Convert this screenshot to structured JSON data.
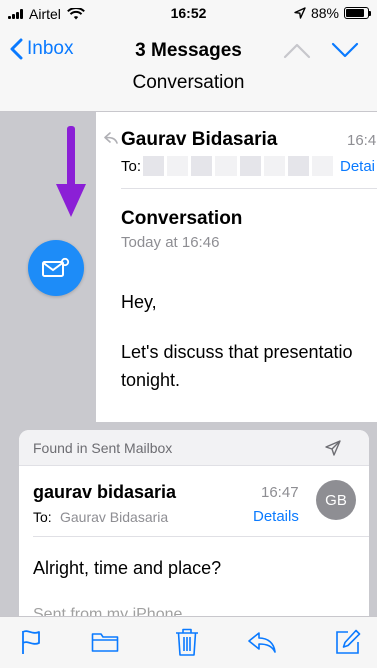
{
  "status_bar": {
    "carrier": "Airtel",
    "time": "16:52",
    "battery": "88%",
    "battery_level": 0.88
  },
  "nav": {
    "back_label": "Inbox",
    "title": "3 Messages",
    "subtitle": "Conversation"
  },
  "message1": {
    "sender": "Gaurav Bidasaria",
    "time": "16:4",
    "to_label": "To:",
    "details": "Detai",
    "subject": "Conversation",
    "date": "Today at 16:46",
    "body": [
      "Hey,",
      "Let's discuss that presentatio tonight."
    ]
  },
  "message2": {
    "found_in": "Found in Sent Mailbox",
    "sender": "gaurav bidasaria",
    "time": "16:47",
    "avatar_initials": "GB",
    "to_label": "To:",
    "to_value": "Gaurav Bidasaria",
    "details": "Details",
    "body": "Alright, time and place?",
    "signature": "Sent from my iPhone"
  },
  "colors": {
    "accent": "#0a7aff",
    "fab": "#1d8cf8",
    "annotation_arrow": "#8b1fd6",
    "background": "#c9c9ce"
  },
  "icons": {
    "back": "chevron-left-icon",
    "prev_message": "chevron-up-icon",
    "next_message": "chevron-down-icon",
    "fab": "envelope-badge-icon",
    "found_in": "send-icon",
    "toolbar": [
      "flag-icon",
      "folder-icon",
      "trash-icon",
      "reply-icon",
      "compose-icon"
    ]
  }
}
